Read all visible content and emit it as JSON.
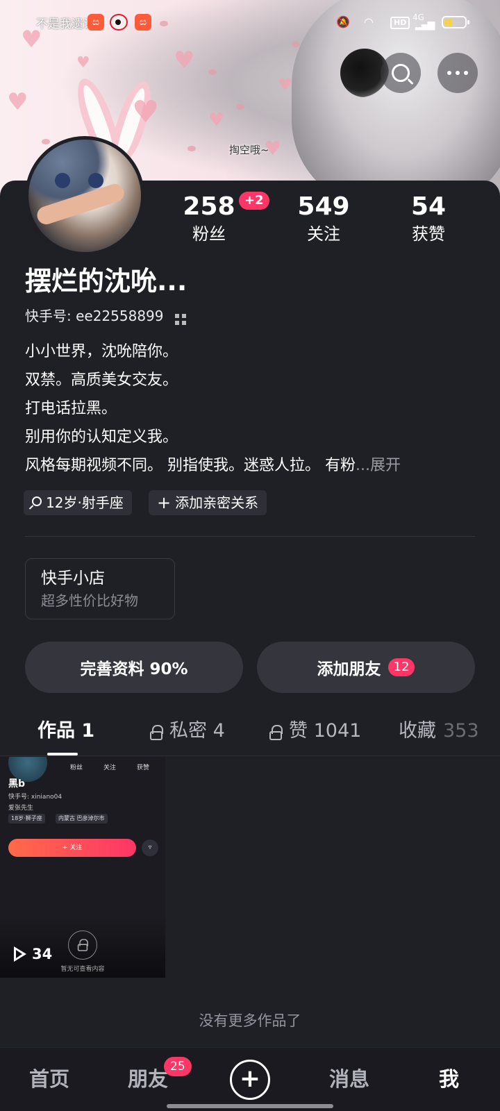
{
  "status_bar": {
    "ticker_text": "不是我遗误",
    "network": "4G",
    "hd_label": "HD"
  },
  "banner": {
    "caption": "掏空哦~"
  },
  "profile": {
    "nickname": "摆烂的沈吮...",
    "kwai_id_label": "快手号: ee22558899",
    "stats": [
      {
        "value": "258",
        "label": "粉丝",
        "badge": "+2"
      },
      {
        "value": "549",
        "label": "关注"
      },
      {
        "value": "54",
        "label": "获赞"
      }
    ],
    "bio_lines": [
      "小小世界，沈吮陪你。",
      "双禁。高质美女交友。",
      "打电话拉黑。",
      "别用你的认知定义我。",
      "风格每期视频不同。 别指使我。迷惑人拉。 有粉"
    ],
    "bio_more": "...展开",
    "tags": [
      "12岁·射手座",
      "添加亲密关系"
    ]
  },
  "shop": {
    "title": "快手小店",
    "subtitle": "超多性价比好物"
  },
  "actions": {
    "complete_profile": "完善资料 90%",
    "add_friend": "添加朋友",
    "add_friend_badge": "12"
  },
  "tabs": [
    {
      "label": "作品 1"
    },
    {
      "label": "私密 4"
    },
    {
      "label": "赞 1041"
    },
    {
      "label": "收藏",
      "count": "353"
    }
  ],
  "work_tile": {
    "mini": {
      "stats": [
        "粉丝",
        "关注",
        "获赞"
      ],
      "name": "黑b",
      "kwai_id": "快手号: xiniano04",
      "bio": "爱张先生",
      "tags": [
        "18岁·狮子座",
        "内蒙古 巴彦淖尔市"
      ],
      "follow": "+ 关注"
    },
    "play_count": "34",
    "note": "暂无可查看内容"
  },
  "no_more_text": "没有更多作品了",
  "bottom_nav": {
    "home": "首页",
    "friends": "朋友",
    "friends_badge": "25",
    "create": "+",
    "messages": "消息",
    "me": "我"
  },
  "colors": {
    "accent": "#fe3666",
    "background": "#1f1f26",
    "surface": "#35353e"
  }
}
